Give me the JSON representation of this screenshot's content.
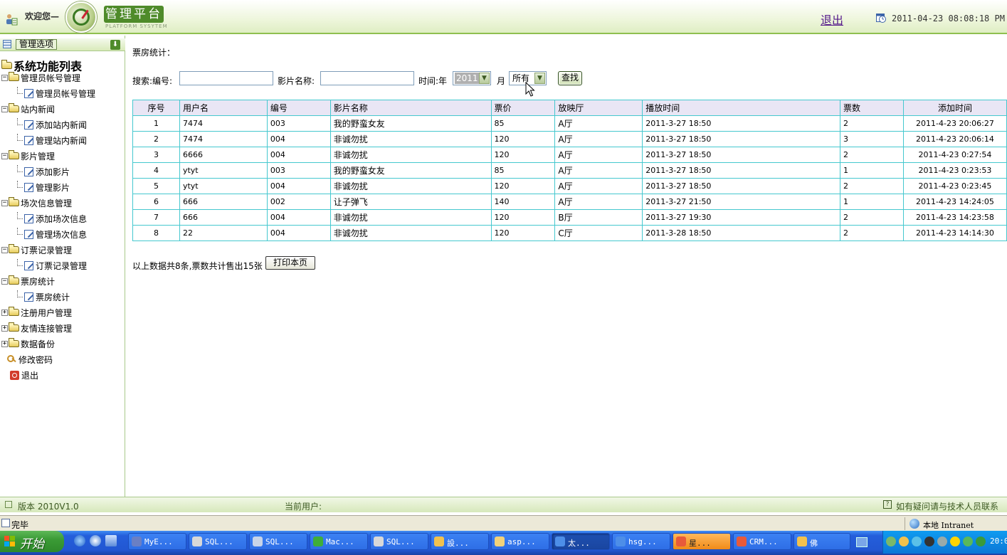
{
  "header": {
    "welcome": "欢迎您—",
    "brand": "管理平台",
    "brand_sub": "PLATFORM SYSYTEM",
    "logout": "退出",
    "datetime": "2011-04-23 08:08:18 PM"
  },
  "sidebar": {
    "header_label": "管理选项",
    "root": "系统功能列表",
    "items": [
      {
        "kind": "group",
        "label": "管理员帐号管理",
        "expanded": true
      },
      {
        "kind": "leaf",
        "label": "管理员帐号管理"
      },
      {
        "kind": "group",
        "label": "站内新闻",
        "expanded": true
      },
      {
        "kind": "leaf",
        "label": "添加站内新闻"
      },
      {
        "kind": "leaf",
        "label": "管理站内新闻"
      },
      {
        "kind": "group",
        "label": "影片管理",
        "expanded": true
      },
      {
        "kind": "leaf",
        "label": "添加影片"
      },
      {
        "kind": "leaf",
        "label": "管理影片"
      },
      {
        "kind": "group",
        "label": "场次信息管理",
        "expanded": true
      },
      {
        "kind": "leaf",
        "label": "添加场次信息"
      },
      {
        "kind": "leaf",
        "label": "管理场次信息"
      },
      {
        "kind": "group",
        "label": "订票记录管理",
        "expanded": true
      },
      {
        "kind": "leaf",
        "label": "订票记录管理"
      },
      {
        "kind": "group",
        "label": "票房统计",
        "expanded": true
      },
      {
        "kind": "leaf",
        "label": "票房统计"
      },
      {
        "kind": "group",
        "label": "注册用户管理",
        "expanded": false
      },
      {
        "kind": "group",
        "label": "友情连接管理",
        "expanded": false
      },
      {
        "kind": "group",
        "label": "数据备份",
        "expanded": false
      },
      {
        "kind": "key",
        "label": "修改密码"
      },
      {
        "kind": "exit",
        "label": "退出"
      }
    ]
  },
  "main": {
    "section_title": "票房统计：",
    "search": {
      "label_search": "搜索:编号:",
      "number_value": "",
      "label_film": "影片名称:",
      "film_value": "",
      "label_time": "时间:年",
      "year_value": "2011",
      "label_month": "月",
      "month_value": "所有",
      "button": "查找"
    },
    "table": {
      "headers": [
        "序号",
        "用户名",
        "编号",
        "影片名称",
        "票价",
        "放映厅",
        "播放时间",
        "票数",
        "添加时间"
      ],
      "rows": [
        [
          "1",
          "7474",
          "003",
          "我的野蛮女友",
          "85",
          "A厅",
          "2011-3-27 18:50",
          "2",
          "2011-4-23 20:06:27"
        ],
        [
          "2",
          "7474",
          "004",
          "非诚勿扰",
          "120",
          "A厅",
          "2011-3-27 18:50",
          "3",
          "2011-4-23 20:06:14"
        ],
        [
          "3",
          "6666",
          "004",
          "非诚勿扰",
          "120",
          "A厅",
          "2011-3-27 18:50",
          "2",
          "2011-4-23 0:27:54"
        ],
        [
          "4",
          "ytyt",
          "003",
          "我的野蛮女友",
          "85",
          "A厅",
          "2011-3-27 18:50",
          "1",
          "2011-4-23 0:23:53"
        ],
        [
          "5",
          "ytyt",
          "004",
          "非诚勿扰",
          "120",
          "A厅",
          "2011-3-27 18:50",
          "2",
          "2011-4-23 0:23:45"
        ],
        [
          "6",
          "666",
          "002",
          "让子弹飞",
          "140",
          "A厅",
          "2011-3-27 21:50",
          "1",
          "2011-4-23 14:24:05"
        ],
        [
          "7",
          "666",
          "004",
          "非诚勿扰",
          "120",
          "B厅",
          "2011-3-27 19:30",
          "2",
          "2011-4-23 14:23:58"
        ],
        [
          "8",
          "22",
          "004",
          "非诚勿扰",
          "120",
          "C厅",
          "2011-3-28 18:50",
          "2",
          "2011-4-23 14:14:30"
        ]
      ]
    },
    "summary": "以上数据共8条,票数共计售出15张",
    "print_button": "打印本页"
  },
  "footer": {
    "version": "版本 2010V1.0",
    "current_user": "当前用户:",
    "help": "如有疑问请与技术人员联系"
  },
  "statusbar": {
    "done": "完毕",
    "zone": "本地 Intranet"
  },
  "taskbar": {
    "start": "开始",
    "tasks": [
      {
        "label": "MyE...",
        "icon_color": "#6a7fc4"
      },
      {
        "label": "SQL...",
        "icon_color": "#d8d8d8"
      },
      {
        "label": "SQL...",
        "icon_color": "#c8d4e8"
      },
      {
        "label": "Mac...",
        "icon_color": "#3fae3a"
      },
      {
        "label": "SQL...",
        "icon_color": "#d8d8d8"
      },
      {
        "label": "設...",
        "icon_color": "#f2c14e"
      },
      {
        "label": "asp...",
        "icon_color": "#f2d27a"
      },
      {
        "label": "太...",
        "icon_color": "#4d8ee8"
      },
      {
        "label": "hsg...",
        "icon_color": "#4d8ee8"
      },
      {
        "label": "星...",
        "icon_color": "#e85a3a"
      },
      {
        "label": "CRM...",
        "icon_color": "#e85a3a"
      },
      {
        "label": "佛",
        "icon_color": "#f2c14e"
      }
    ],
    "clock": "20:0"
  }
}
